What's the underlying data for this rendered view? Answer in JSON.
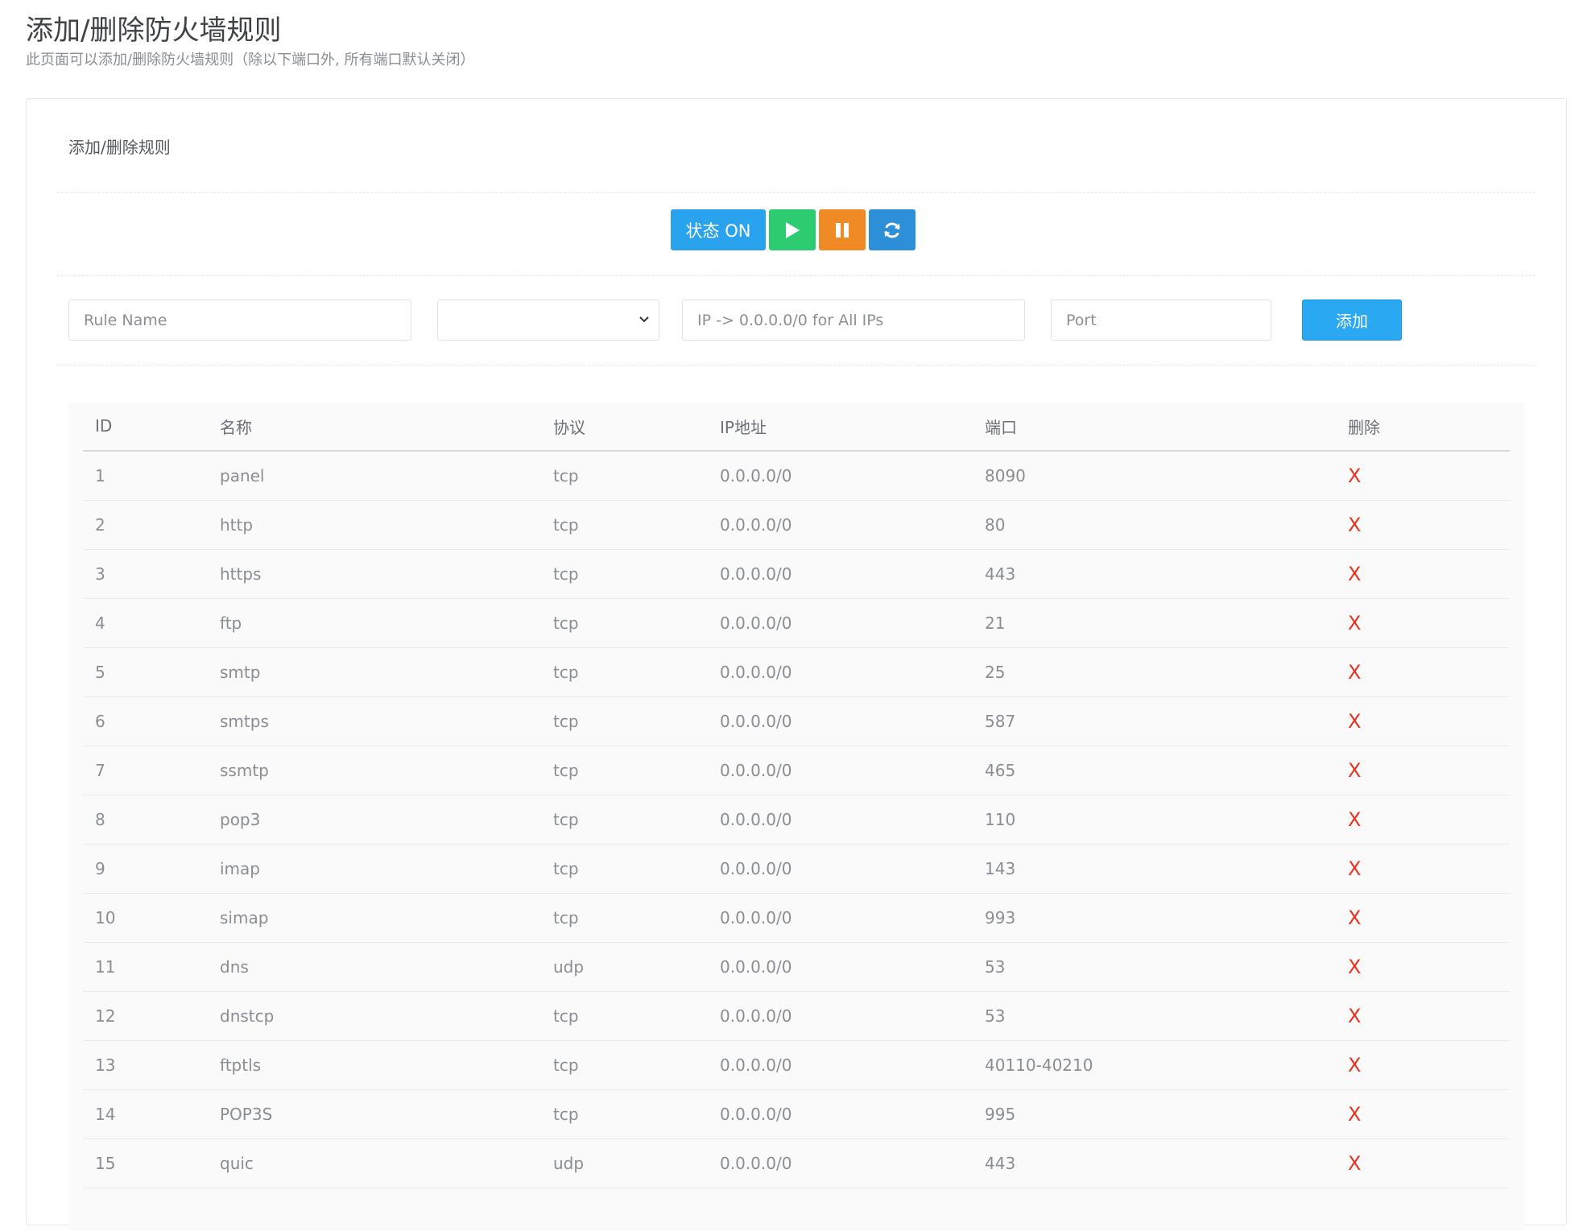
{
  "header": {
    "title": "添加/删除防火墙规则",
    "subtitle": "此页面可以添加/删除防火墙规则（除以下端口外, 所有端口默认关闭）"
  },
  "panel": {
    "title": "添加/删除规则"
  },
  "controls": {
    "status_label": "状态 ON",
    "play_icon": "play-icon",
    "pause_icon": "pause-icon",
    "refresh_icon": "refresh-icon",
    "colors": {
      "status": "#2aa3ef",
      "play": "#2ecc71",
      "pause": "#f08a24",
      "refresh": "#2d8fd8"
    }
  },
  "form": {
    "rule_name_placeholder": "Rule Name",
    "protocol_selected": "",
    "ip_placeholder": "IP -> 0.0.0.0/0 for All IPs",
    "port_placeholder": "Port",
    "add_label": "添加"
  },
  "table": {
    "headers": [
      "ID",
      "名称",
      "协议",
      "IP地址",
      "端口",
      "删除"
    ],
    "delete_symbol": "X",
    "rows": [
      {
        "id": "1",
        "name": "panel",
        "protocol": "tcp",
        "ip": "0.0.0.0/0",
        "port": "8090"
      },
      {
        "id": "2",
        "name": "http",
        "protocol": "tcp",
        "ip": "0.0.0.0/0",
        "port": "80"
      },
      {
        "id": "3",
        "name": "https",
        "protocol": "tcp",
        "ip": "0.0.0.0/0",
        "port": "443"
      },
      {
        "id": "4",
        "name": "ftp",
        "protocol": "tcp",
        "ip": "0.0.0.0/0",
        "port": "21"
      },
      {
        "id": "5",
        "name": "smtp",
        "protocol": "tcp",
        "ip": "0.0.0.0/0",
        "port": "25"
      },
      {
        "id": "6",
        "name": "smtps",
        "protocol": "tcp",
        "ip": "0.0.0.0/0",
        "port": "587"
      },
      {
        "id": "7",
        "name": "ssmtp",
        "protocol": "tcp",
        "ip": "0.0.0.0/0",
        "port": "465"
      },
      {
        "id": "8",
        "name": "pop3",
        "protocol": "tcp",
        "ip": "0.0.0.0/0",
        "port": "110"
      },
      {
        "id": "9",
        "name": "imap",
        "protocol": "tcp",
        "ip": "0.0.0.0/0",
        "port": "143"
      },
      {
        "id": "10",
        "name": "simap",
        "protocol": "tcp",
        "ip": "0.0.0.0/0",
        "port": "993"
      },
      {
        "id": "11",
        "name": "dns",
        "protocol": "udp",
        "ip": "0.0.0.0/0",
        "port": "53"
      },
      {
        "id": "12",
        "name": "dnstcp",
        "protocol": "tcp",
        "ip": "0.0.0.0/0",
        "port": "53"
      },
      {
        "id": "13",
        "name": "ftptls",
        "protocol": "tcp",
        "ip": "0.0.0.0/0",
        "port": "40110-40210"
      },
      {
        "id": "14",
        "name": "POP3S",
        "protocol": "tcp",
        "ip": "0.0.0.0/0",
        "port": "995"
      },
      {
        "id": "15",
        "name": "quic",
        "protocol": "udp",
        "ip": "0.0.0.0/0",
        "port": "443"
      }
    ]
  }
}
